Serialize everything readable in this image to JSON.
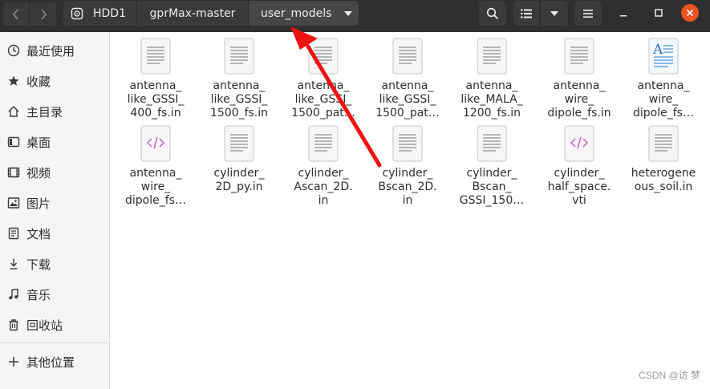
{
  "toolbar": {
    "back_icon": "chevron-left-icon",
    "forward_icon": "chevron-right-icon",
    "path": [
      {
        "label": "HDD1",
        "icon": "drive-icon"
      },
      {
        "label": "gprMax-master"
      },
      {
        "label": "user_models",
        "icon": "chevron-down-icon"
      }
    ],
    "search_icon": "search-icon",
    "view_icon": "list-view-icon",
    "view_menu_icon": "chevron-down-icon",
    "menu_icon": "hamburger-menu-icon"
  },
  "window": {
    "minimize_icon": "minimize-icon",
    "maximize_icon": "maximize-icon",
    "close_icon": "close-icon",
    "close_color": "#e95420"
  },
  "sidebar": {
    "items": [
      {
        "label": "最近使用",
        "icon": "clock-icon"
      },
      {
        "label": "收藏",
        "icon": "star-icon"
      },
      {
        "label": "主目录",
        "icon": "home-icon"
      },
      {
        "label": "桌面",
        "icon": "desktop-icon"
      },
      {
        "label": "视频",
        "icon": "video-icon"
      },
      {
        "label": "图片",
        "icon": "picture-icon"
      },
      {
        "label": "文档",
        "icon": "document-icon"
      },
      {
        "label": "下载",
        "icon": "download-icon"
      },
      {
        "label": "音乐",
        "icon": "music-icon"
      },
      {
        "label": "回收站",
        "icon": "trash-icon"
      }
    ],
    "other": {
      "label": "其他位置",
      "icon": "plus-icon"
    }
  },
  "files": [
    {
      "name": "antenna_\nlike_GSSI_\n400_fs.in",
      "type": "text"
    },
    {
      "name": "antenna_\nlike_GSSI_\n1500_fs.in",
      "type": "text"
    },
    {
      "name": "antenna_\nlike_GSSI_\n1500_pat…",
      "type": "text"
    },
    {
      "name": "antenna_\nlike_GSSI_\n1500_pat…",
      "type": "text"
    },
    {
      "name": "antenna_\nlike_MALA_\n1200_fs.in",
      "type": "text"
    },
    {
      "name": "antenna_\nwire_\ndipole_fs.in",
      "type": "text"
    },
    {
      "name": "antenna_\nwire_\ndipole_fs…",
      "type": "richtext"
    },
    {
      "name": "antenna_\nwire_\ndipole_fs…",
      "type": "markup"
    },
    {
      "name": "cylinder_\n2D_py.in",
      "type": "text"
    },
    {
      "name": "cylinder_\nAscan_2D.\nin",
      "type": "text"
    },
    {
      "name": "cylinder_\nBscan_2D.\nin",
      "type": "text"
    },
    {
      "name": "cylinder_\nBscan_\nGSSI_150…",
      "type": "text"
    },
    {
      "name": "cylinder_\nhalf_space.\nvti",
      "type": "markup"
    },
    {
      "name": "heterogene\nous_soil.in",
      "type": "text"
    }
  ],
  "annotation_color": "#ee1111",
  "watermark": "CSDN @访 梦"
}
